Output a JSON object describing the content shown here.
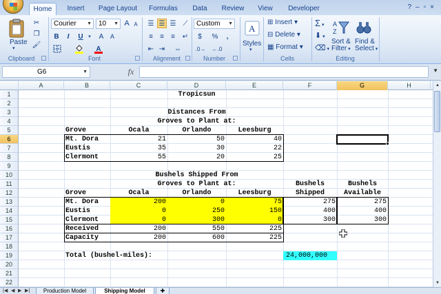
{
  "ribbon": {
    "tabs": [
      "Home",
      "Insert",
      "Page Layout",
      "Formulas",
      "Data",
      "Review",
      "View",
      "Developer"
    ],
    "active_tab": "Home",
    "clipboard": {
      "paste_label": "Paste",
      "group_label": "Clipboard"
    },
    "font": {
      "name": "Courier",
      "size": "10",
      "group_label": "Font",
      "bold": "B",
      "italic": "I",
      "underline": "U",
      "font_color_label": "A"
    },
    "alignment": {
      "group_label": "Alignment"
    },
    "number": {
      "format": "Custom",
      "currency": "$",
      "percent": "%",
      "comma": ",",
      "group_label": "Number"
    },
    "styles": {
      "label": "Styles"
    },
    "cells": {
      "insert": "Insert",
      "delete": "Delete",
      "format": "Format",
      "group_label": "Cells"
    },
    "editing": {
      "sort_filter": "Sort &",
      "sort_filter_2": "Filter",
      "find_select": "Find &",
      "find_select_2": "Select",
      "group_label": "Editing",
      "sigma": "Σ"
    }
  },
  "formula_bar": {
    "name_box": "G6",
    "fx": "fx",
    "formula": ""
  },
  "columns": [
    "A",
    "B",
    "C",
    "D",
    "E",
    "F",
    "G",
    "H"
  ],
  "selected_column": "G",
  "rows": [
    "1",
    "2",
    "3",
    "4",
    "5",
    "6",
    "7",
    "8",
    "9",
    "10",
    "11",
    "12",
    "13",
    "14",
    "15",
    "16",
    "17",
    "18",
    "19",
    "20",
    "21",
    "22"
  ],
  "selected_row": "6",
  "sheet": {
    "title": "Tropicsun",
    "distances_header_1": "Distances From",
    "distances_header_2": "Groves to Plant at:",
    "grove_label": "Grove",
    "plants": [
      "Ocala",
      "Orlando",
      "Leesburg"
    ],
    "distances": [
      {
        "grove": "Mt. Dora",
        "values": [
          "21",
          "50",
          "40"
        ]
      },
      {
        "grove": "Eustis",
        "values": [
          "35",
          "30",
          "22"
        ]
      },
      {
        "grove": "Clermont",
        "values": [
          "55",
          "20",
          "25"
        ]
      }
    ],
    "shipped_header_1": "Bushels Shipped From",
    "shipped_header_2": "Groves to Plant at:",
    "bushels_label": "Bushels",
    "shipped_label": "Shipped",
    "available_label": "Available",
    "shipped": [
      {
        "grove": "Mt. Dora",
        "values": [
          "200",
          "0",
          "75"
        ],
        "shipped": "275",
        "available": "275"
      },
      {
        "grove": "Eustis",
        "values": [
          "0",
          "250",
          "150"
        ],
        "shipped": "400",
        "available": "400"
      },
      {
        "grove": "Clermont",
        "values": [
          "0",
          "300",
          "0"
        ],
        "shipped": "300",
        "available": "300"
      }
    ],
    "received_label": "Received",
    "received": [
      "200",
      "550",
      "225"
    ],
    "capacity_label": "Capacity",
    "capacity": [
      "200",
      "600",
      "225"
    ],
    "total_label": "Total (bushel-miles):",
    "total_value": "24,000,000"
  },
  "sheet_tabs": [
    "Production Model",
    "Shipping Model"
  ],
  "active_sheet": "Shipping Model",
  "colors": {
    "input_fill": "#ffff00",
    "output_fill": "#33ffff",
    "selection": "#f1c15f"
  }
}
